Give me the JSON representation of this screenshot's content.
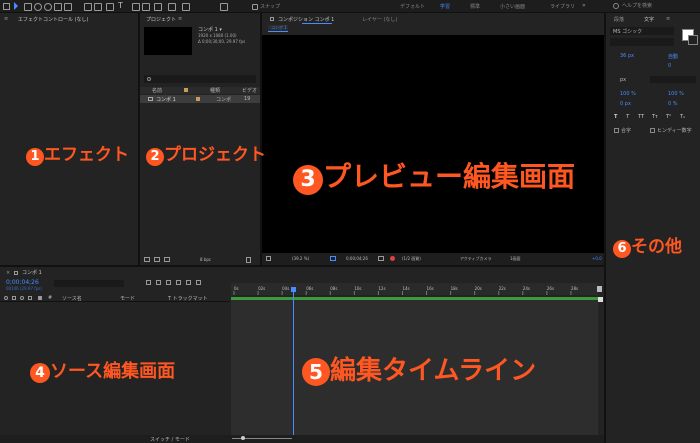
{
  "toolbar": {
    "snap_label": "スナップ",
    "workspaces": [
      "デフォルト",
      "学習",
      "標準",
      "小さい画面",
      "ライブラリ"
    ],
    "search_placeholder": "ヘルプを検索"
  },
  "effect_panel": {
    "tab": "エフェクトコントロール (なし)"
  },
  "project_panel": {
    "tab": "プロジェクト",
    "comp_name": "コンポ 1 ▾",
    "comp_size": "1920 x 1080 (1.00)",
    "comp_duration": "Δ 0;00;30;00, 29.97 fps",
    "search_icon": "search-icon",
    "columns": [
      "名前",
      "種類",
      "ビデオ"
    ],
    "row": {
      "name": "コンポ 1",
      "type": "コンポ",
      "extra": "19"
    },
    "bpc": "8 bpc"
  },
  "comp_panel": {
    "tab": "コンポジション コンポ 1",
    "layer_tab": "レイヤー (なし)",
    "sub_tab": "コンポ 1",
    "zoom": "(39.2 %)",
    "timecode": "0;00;04;26",
    "resolution": "(1/2 画質)",
    "camera": "アクティブカメラ",
    "views": "1画面",
    "offset": "+0.0"
  },
  "right_panel": {
    "tabs": [
      "段落",
      "文字"
    ],
    "font": "MS ゴシック",
    "size": "36 px",
    "leading": "自動",
    "tracking": "0",
    "scale_v": "100 %",
    "scale_h": "100 %",
    "baseline": "0 px",
    "tsume": "0 %",
    "px_label": "px",
    "ligature": "合字",
    "hindi": "ヒンディー数字",
    "styles": [
      "T",
      "T",
      "TT",
      "Tт",
      "T¹",
      "T₁"
    ]
  },
  "timeline": {
    "tab": "コンポ 1",
    "timecode": "0;00;04;26",
    "fps_info": "00146 (29.97 fps)",
    "col_source": "ソース名",
    "col_mode": "モード",
    "col_trkmat": "T  トラックマット",
    "switch_label": "スイッチ / モード",
    "ticks": [
      "0s",
      "02s",
      "04s",
      "06s",
      "08s",
      "10s",
      "12s",
      "14s",
      "16s",
      "18s",
      "20s",
      "22s",
      "24s",
      "26s",
      "28s"
    ],
    "playhead_seconds": 4.9
  },
  "callouts": {
    "c1": {
      "num": "1",
      "text": "エフェクト"
    },
    "c2": {
      "num": "2",
      "text": "プロジェクト"
    },
    "c3": {
      "num": "3",
      "text": "プレビュー編集画面"
    },
    "c4": {
      "num": "4",
      "text": "ソース編集画面"
    },
    "c5": {
      "num": "5",
      "text": "編集タイムライン"
    },
    "c6": {
      "num": "6",
      "text": "その他"
    }
  },
  "colors": {
    "accent": "#ff5722",
    "highlight_blue": "#4a8cff",
    "bar_green": "#3a9b3a"
  }
}
